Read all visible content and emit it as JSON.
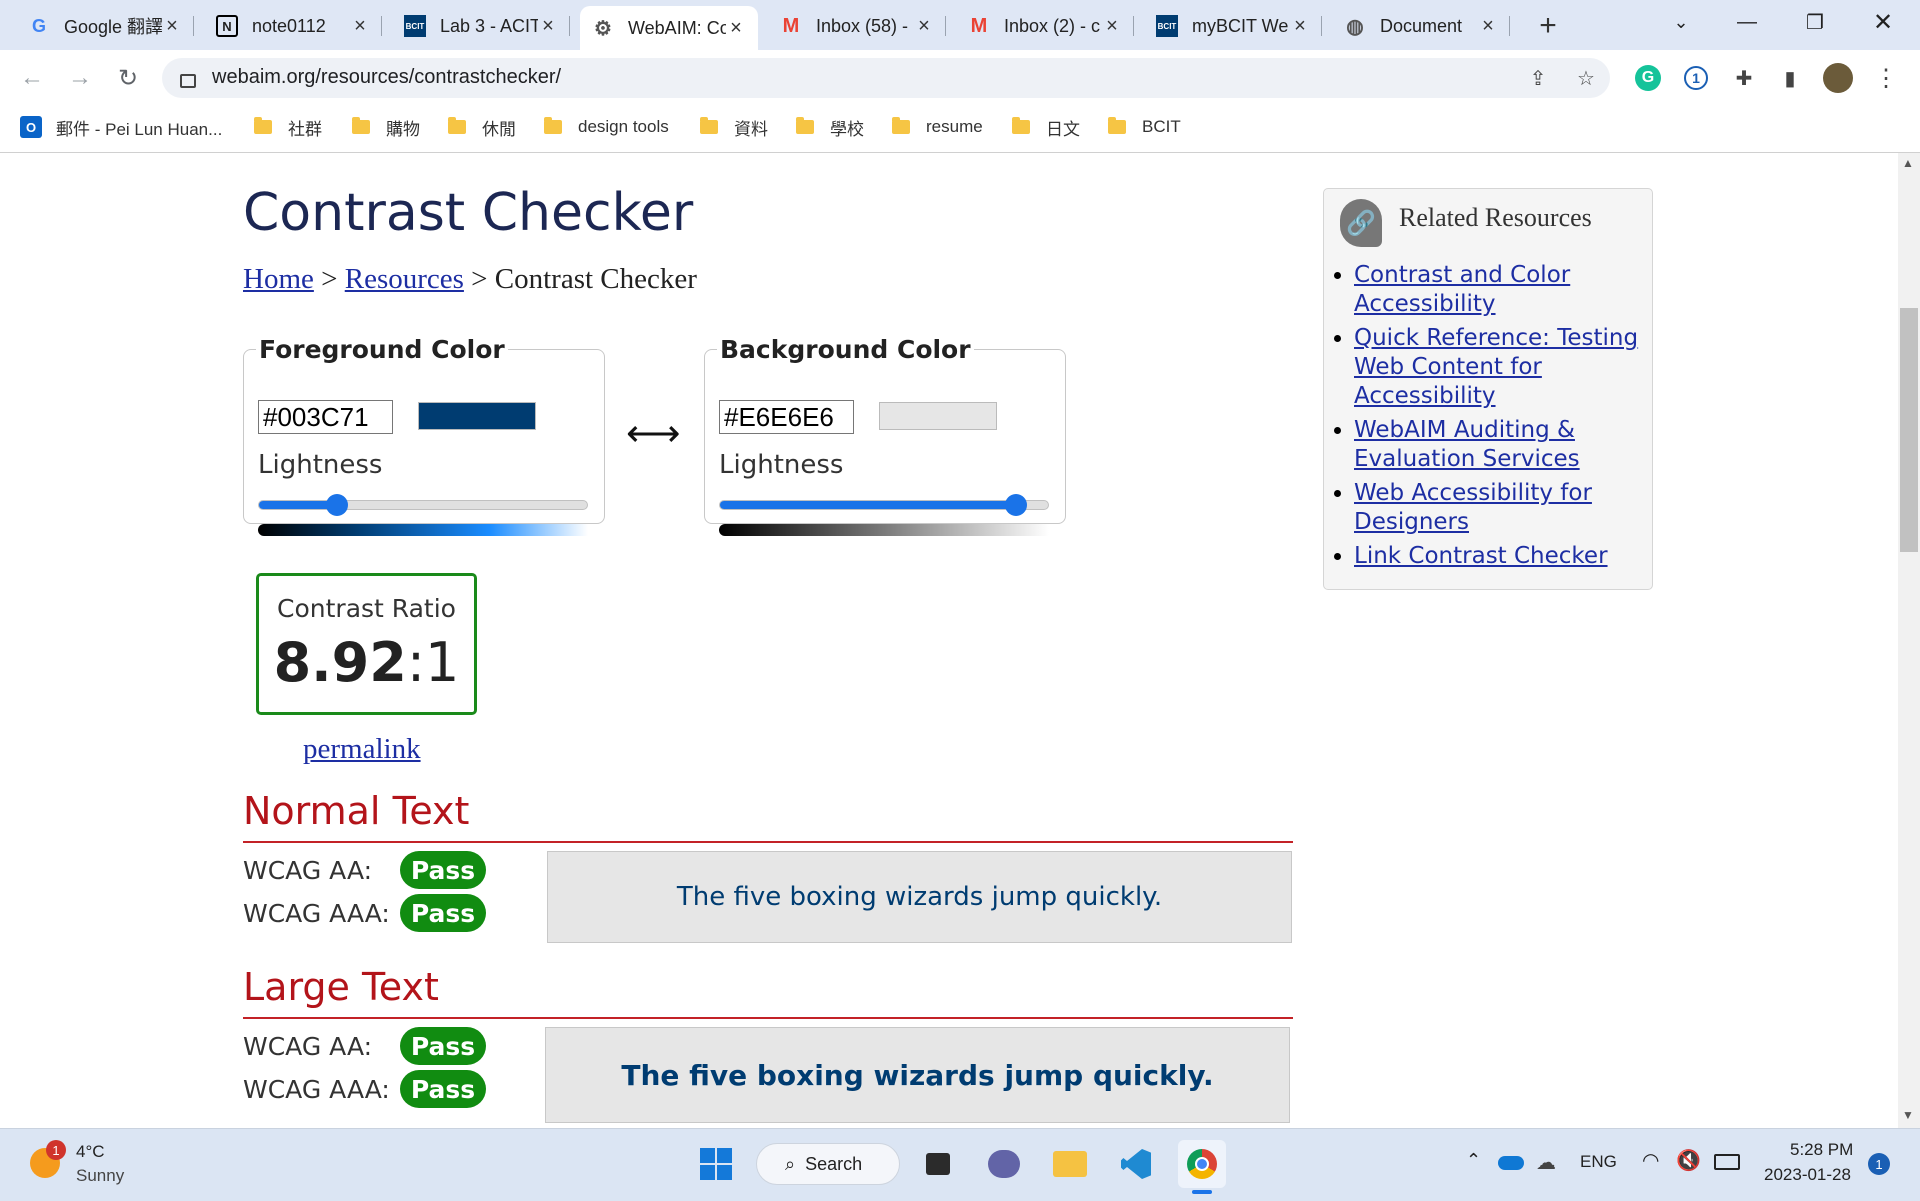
{
  "tabs": [
    {
      "title": "Google 翻譯",
      "favicon": "G",
      "color": "#4285f4"
    },
    {
      "title": "note0112",
      "favicon": "N",
      "color": "#000000"
    },
    {
      "title": "Lab 3 - ACIT",
      "favicon": "BCIT",
      "color": "#003c71"
    },
    {
      "title": "WebAIM: Co",
      "favicon": "gear",
      "color": "#555555",
      "active": true
    },
    {
      "title": "Inbox (58) -",
      "favicon": "M",
      "color": "#ea4335"
    },
    {
      "title": "Inbox (2) - c",
      "favicon": "M",
      "color": "#ea4335"
    },
    {
      "title": "myBCIT We",
      "favicon": "BCIT",
      "color": "#003c71"
    },
    {
      "title": "Document",
      "favicon": "globe",
      "color": "#555555"
    }
  ],
  "address": {
    "url": "webaim.org/resources/contrastchecker/"
  },
  "bookmarks": [
    {
      "label": "郵件 - Pei Lun Huan...",
      "type": "outlook"
    },
    {
      "label": "社群",
      "type": "folder"
    },
    {
      "label": "購物",
      "type": "folder"
    },
    {
      "label": "休閒",
      "type": "folder"
    },
    {
      "label": "design tools",
      "type": "folder"
    },
    {
      "label": "資料",
      "type": "folder"
    },
    {
      "label": "學校",
      "type": "folder"
    },
    {
      "label": "resume",
      "type": "folder"
    },
    {
      "label": "日文",
      "type": "folder"
    },
    {
      "label": "BCIT",
      "type": "folder"
    }
  ],
  "page": {
    "title": "Contrast Checker",
    "breadcrumb": {
      "home": "Home",
      "resources": "Resources",
      "current": "Contrast Checker",
      "sep": ">"
    },
    "foreground": {
      "legend": "Foreground Color",
      "hex": "#003C71",
      "swatch": "#003c71",
      "lightness_label": "Lightness",
      "lightness": 0.24
    },
    "background": {
      "legend": "Background Color",
      "hex": "#E6E6E6",
      "swatch": "#e6e6e6",
      "lightness_label": "Lightness",
      "lightness": 0.9
    },
    "swap_symbol": "⟷",
    "ratio": {
      "label": "Contrast Ratio",
      "value": "8.92",
      "suffix": ":1"
    },
    "permalink": "permalink",
    "normal": {
      "heading": "Normal Text",
      "aa_label": "WCAG AA:",
      "aa_result": "Pass",
      "aaa_label": "WCAG AAA:",
      "aaa_result": "Pass",
      "sample": "The five boxing wizards jump quickly."
    },
    "large": {
      "heading": "Large Text",
      "aa_label": "WCAG AA:",
      "aa_result": "Pass",
      "aaa_label": "WCAG AAA:",
      "aaa_result": "Pass",
      "sample": "The five boxing wizards jump quickly."
    },
    "related": {
      "heading": "Related Resources",
      "links": [
        "Contrast and Color Accessibility",
        "Quick Reference: Testing Web Content for Accessibility",
        "WebAIM Auditing & Evaluation Services",
        "Web Accessibility for Designers",
        "Link Contrast Checker"
      ]
    }
  },
  "taskbar": {
    "weather": {
      "temp": "4°C",
      "condition": "Sunny",
      "badge": "1"
    },
    "search": "Search",
    "lang": "ENG",
    "time": "5:28 PM",
    "date": "2023-01-28",
    "notifications": "1"
  }
}
